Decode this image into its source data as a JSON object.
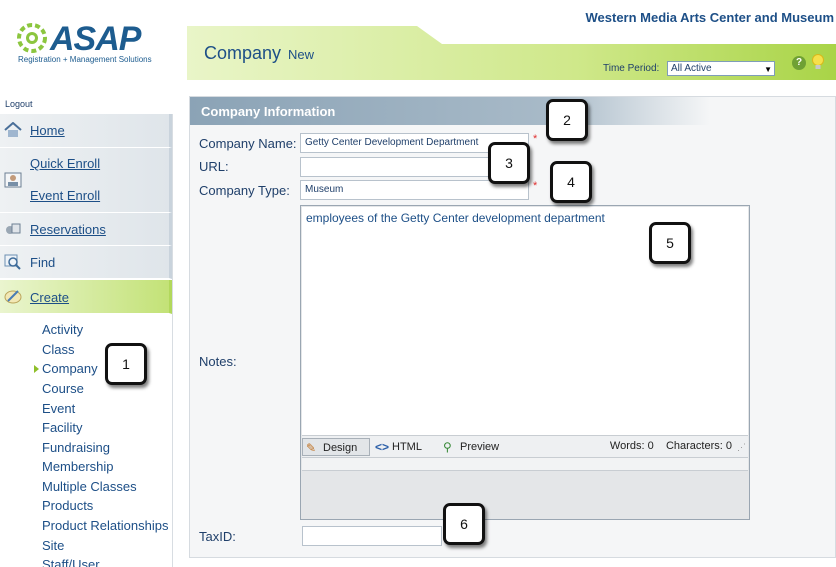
{
  "header": {
    "logo_text": "ASAP",
    "logo_tagline": "Registration + Management Solutions",
    "org_name": "Western Media Arts Center and Museum",
    "page_title": "Company",
    "page_mode": "New",
    "time_period_label": "Time Period:",
    "time_period_value": "All Active",
    "help_icon_glyph": "?"
  },
  "sidebar": {
    "logout": "Logout",
    "nav": [
      {
        "label": "Home",
        "icon": "home-icon"
      },
      {
        "label": "Quick Enroll",
        "icon": "person-card-icon"
      },
      {
        "label": "Event Enroll",
        "icon": "person-card-icon"
      },
      {
        "label": "Reservations",
        "icon": "reservations-icon"
      },
      {
        "label": "Find",
        "icon": "magnifier-icon"
      },
      {
        "label": "Create",
        "icon": "create-icon"
      }
    ],
    "create_items": [
      "Activity",
      "Class",
      "Company",
      "Course",
      "Event",
      "Facility",
      "Fundraising",
      "Membership",
      "Multiple Classes",
      "Products",
      "Product Relationships",
      "Site",
      "Staff/User"
    ],
    "active_item": "Company"
  },
  "panel": {
    "title": "Company Information",
    "company_name_label": "Company Name:",
    "company_name_value": "Getty Center Development Department",
    "url_label": "URL:",
    "url_value": "",
    "company_type_label": "Company Type:",
    "company_type_value": "Museum",
    "notes_label": "Notes:",
    "notes_value": "employees of the Getty Center development department",
    "taxid_label": "TaxID:",
    "taxid_value": "",
    "required_mark": "*"
  },
  "editor": {
    "tab_design": "Design",
    "tab_html": "HTML",
    "tab_preview": "Preview",
    "word_count": "Words: 0",
    "char_count": "Characters: 0"
  },
  "callouts": [
    "1",
    "2",
    "3",
    "4",
    "5",
    "6"
  ],
  "colors": {
    "brand_blue": "#1d4f87",
    "brand_green": "#9ccf2f",
    "required_red": "#e03030"
  }
}
